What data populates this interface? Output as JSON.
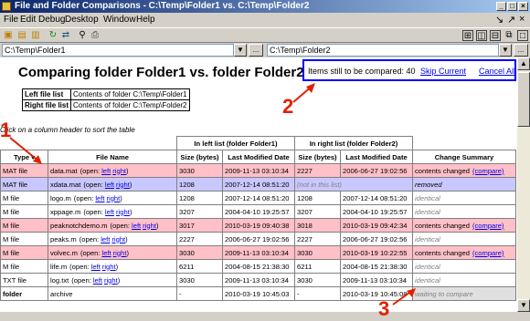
{
  "window": {
    "title": "File and Folder Comparisons - C:\\Temp\\Folder1 vs. C:\\Temp\\Folder2"
  },
  "menu": [
    "File",
    "Edit",
    "Debug",
    "Desktop",
    "Window",
    "Help"
  ],
  "paths": {
    "left": "C:\\Temp\\Folder1",
    "right": "C:\\Temp\\Folder2",
    "browse_label": "..."
  },
  "heading": "Comparing folder Folder1 vs. folder Folder2",
  "progress": {
    "text": "Items still to be compared: 40",
    "skip": "Skip Current",
    "cancel": "Cancel All"
  },
  "filelist": [
    {
      "label": "Left file list",
      "value": "Contents of folder  C:\\Temp\\Folder1"
    },
    {
      "label": "Right file list",
      "value": "Contents of folder  C:\\Temp\\Folder2"
    }
  ],
  "hint": "Click on a column header to sort the table",
  "table": {
    "group_left": "In left list  (folder Folder1)",
    "group_right": "In right list  (folder Folder2)",
    "headers": {
      "type": "Type ▾",
      "name": "File Name",
      "size": "Size (bytes)",
      "date": "Last Modified Date",
      "summary": "Change Summary"
    },
    "open_label": "(open:",
    "left_link": "left",
    "right_link": "right",
    "close_paren": ")",
    "rows": [
      {
        "type": "MAT file",
        "name": "data.mat",
        "open": true,
        "lsize": "3030",
        "ldate": "2009-11-13 03:10:34",
        "rsize": "2227",
        "rdate": "2006-06-27 19:02:56",
        "summary": "contents changed",
        "compare": "(compare)",
        "style": "pink"
      },
      {
        "type": "MAT file",
        "name": "xdata.mat",
        "open": true,
        "lsize": "1208",
        "ldate": "2007-12-14 08:51:20",
        "rsize": "(not in this list)",
        "rdate": "",
        "summary": "removed",
        "compare": "",
        "style": "blue"
      },
      {
        "type": "M file",
        "name": "logo.m",
        "open": true,
        "lsize": "1208",
        "ldate": "2007-12-14 08:51:20",
        "rsize": "1208",
        "rdate": "2007-12-14 08:51:20",
        "summary": "identical",
        "compare": "",
        "style": "none"
      },
      {
        "type": "M file",
        "name": "xppage.m",
        "open": true,
        "lsize": "3207",
        "ldate": "2004-04-10 19:25:57",
        "rsize": "3207",
        "rdate": "2004-04-10 19:25:57",
        "summary": "identical",
        "compare": "",
        "style": "none"
      },
      {
        "type": "M file",
        "name": "peaknotchdemo.m",
        "open": true,
        "lsize": "3017",
        "ldate": "2010-03-19 09:40:38",
        "rsize": "3018",
        "rdate": "2010-03-19 09:42:34",
        "summary": "contents changed",
        "compare": "(compare)",
        "style": "pink"
      },
      {
        "type": "M file",
        "name": "peaks.m",
        "open": true,
        "lsize": "2227",
        "ldate": "2006-06-27 19:02:56",
        "rsize": "2227",
        "rdate": "2006-06-27 19:02:56",
        "summary": "identical",
        "compare": "",
        "style": "none"
      },
      {
        "type": "M file",
        "name": "volvec.m",
        "open": true,
        "lsize": "3030",
        "ldate": "2009-11-13 03:10:34",
        "rsize": "3030",
        "rdate": "2010-03-19 10:22:55",
        "summary": "contents changed",
        "compare": "(compare)",
        "style": "pink"
      },
      {
        "type": "M file",
        "name": "life.m",
        "open": true,
        "lsize": "6211",
        "ldate": "2004-08-15 21:38:30",
        "rsize": "6211",
        "rdate": "2004-08-15 21:38:30",
        "summary": "identical",
        "compare": "",
        "style": "none"
      },
      {
        "type": "TXT file",
        "name": "log.txt",
        "open": true,
        "lsize": "3030",
        "ldate": "2009-11-13 03:10:34",
        "rsize": "3030",
        "rdate": "2009-11-13 03:10:34",
        "summary": "identical",
        "compare": "",
        "style": "none"
      },
      {
        "type": "folder",
        "name": "archive",
        "open": false,
        "lsize": "-",
        "ldate": "2010-03-19 10:45:03",
        "rsize": "-",
        "rdate": "2010-03-19 10:45:08",
        "summary": "waiting to compare",
        "compare": "",
        "style": "folder"
      }
    ]
  },
  "annotations": [
    "1",
    "2",
    "3"
  ],
  "colors": {
    "changed": "#ffc0c8",
    "removed": "#c8c8ff",
    "annotation": "#e02000",
    "highlight_box": "#0000ff"
  }
}
